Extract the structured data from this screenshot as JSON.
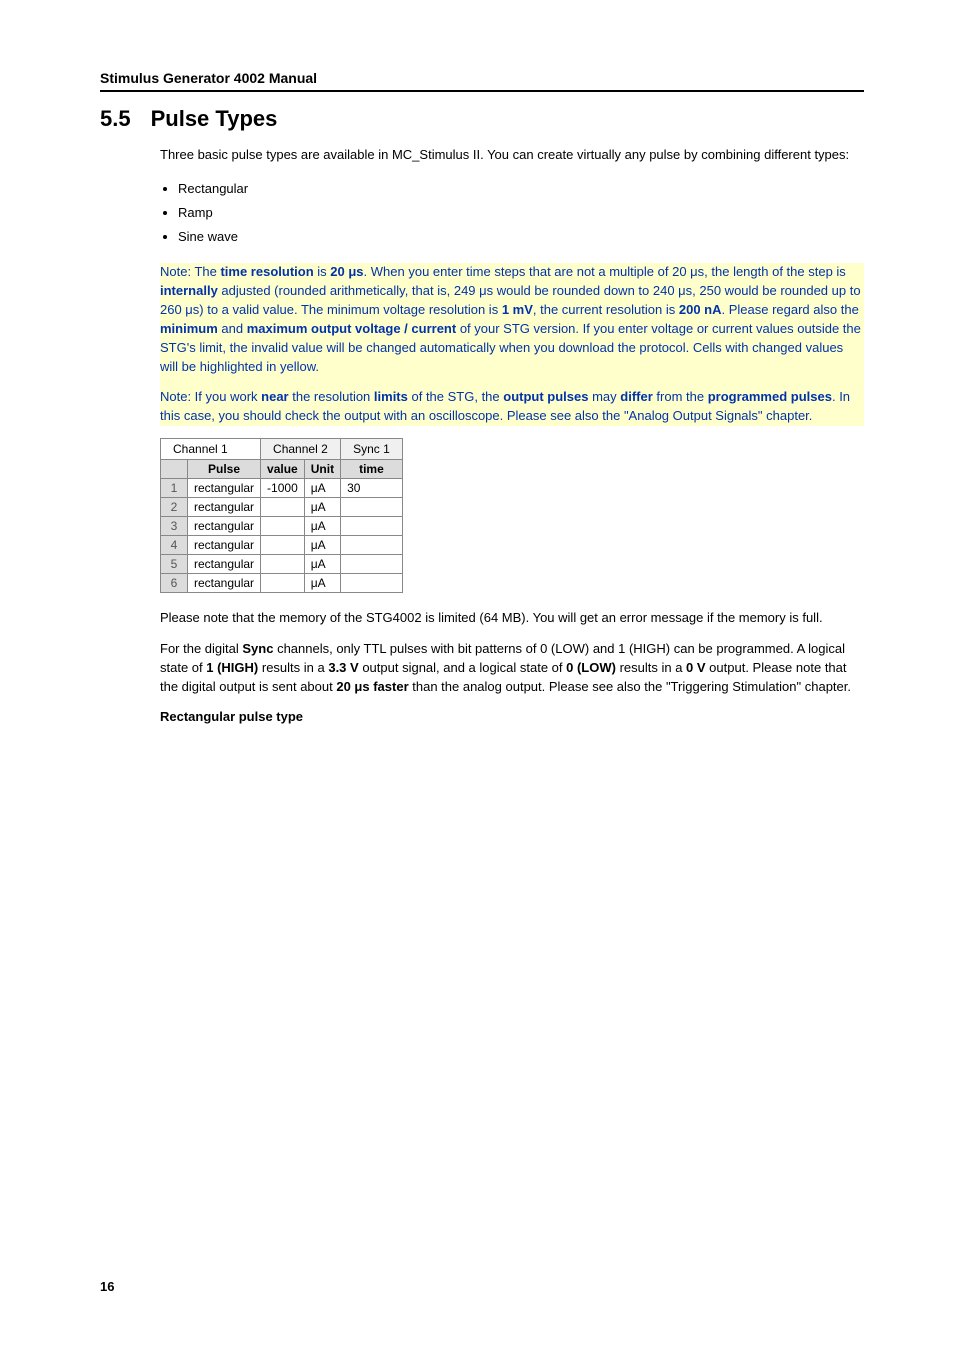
{
  "running_head": "Stimulus Generator 4002 Manual",
  "section": {
    "num": "5.5",
    "title": "Pulse Types"
  },
  "intro": "Three basic pulse types are available in MC_Stimulus II. You can create virtually any pulse by combining different types:",
  "bullets": [
    "Rectangular",
    "Ramp",
    "Sine wave"
  ],
  "note1": {
    "pre": "Note: The ",
    "b1": "time resolution",
    "t1": " is ",
    "b2": "20 μs",
    "t2": ". When you enter time steps that are not a multiple of 20 μs, the length of the step is ",
    "b3": "internally",
    "t3": " adjusted (rounded arithmetically, that is, 249 μs would be rounded down to 240 μs, 250 would be rounded up to 260 μs) to a valid value. The minimum voltage resolution is ",
    "b4": "1 mV",
    "t4": ", the current resolution is ",
    "b5": "200 nA",
    "t5": ". Please regard also the ",
    "b6": "minimum",
    "t6": " and ",
    "b7": "maximum output voltage / current",
    "t7": " of your STG version. If you enter voltage or current values outside the STG's limit, the invalid value will be changed automatically when you download the protocol. Cells with changed values will be highlighted in yellow."
  },
  "note2": {
    "pre": "Note: If you work ",
    "b1": "near",
    "t1": " the resolution ",
    "b2": "limits",
    "t2": " of the STG, the ",
    "b3": "output pulses",
    "t3": " may ",
    "b4": "differ",
    "t4": " from the ",
    "b5": "programmed pulses",
    "t5": ". In this case, you should check the output with an oscilloscope. Please see also the \"Analog Output Signals\" chapter."
  },
  "table": {
    "tabs": [
      "Channel 1",
      "Channel 2",
      "Sync 1"
    ],
    "headers": [
      "Pulse",
      "value",
      "Unit",
      "time"
    ],
    "rows": [
      {
        "n": "1",
        "pulse": "rectangular",
        "value": "-1000",
        "unit": "μA",
        "time": "30",
        "hl": true
      },
      {
        "n": "2",
        "pulse": "rectangular",
        "value": "",
        "unit": "μA",
        "time": ""
      },
      {
        "n": "3",
        "pulse": "rectangular",
        "value": "",
        "unit": "μA",
        "time": ""
      },
      {
        "n": "4",
        "pulse": "rectangular",
        "value": "",
        "unit": "μA",
        "time": ""
      },
      {
        "n": "5",
        "pulse": "rectangular",
        "value": "",
        "unit": "μA",
        "time": ""
      },
      {
        "n": "6",
        "pulse": "rectangular",
        "value": "",
        "unit": "μA",
        "time": ""
      }
    ]
  },
  "para_mem": "Please note that the memory of the STG4002 is limited (64 MB). You will get an error message if the memory is full.",
  "para_sync": {
    "t0": "For the digital ",
    "b0": "Sync",
    "t1": " channels, only TTL pulses with bit patterns of 0 (LOW) and 1 (HIGH) can be programmed. A logical state of ",
    "b1": "1 (HIGH)",
    "t2": " results in a ",
    "b2": "3.3 V",
    "t3": " output signal, and a logical state of ",
    "b3": "0 (LOW)",
    "t4": " results in a ",
    "b4": "0 V",
    "t5": " output. Please note that the digital output is sent about ",
    "b5": "20 μs faster",
    "t6": " than the analog output. Please see also the \"Triggering Stimulation\" chapter."
  },
  "subhead": "Rectangular pulse type",
  "pagenum": "16"
}
